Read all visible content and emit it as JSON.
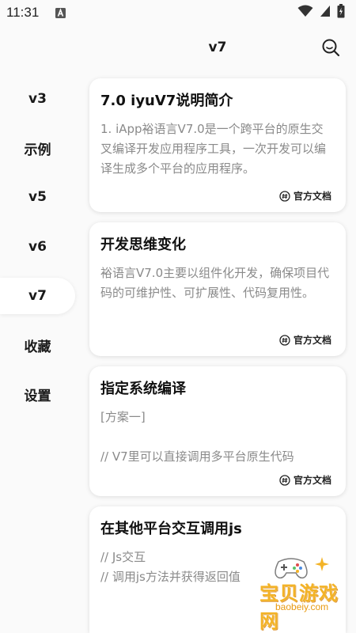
{
  "status_bar": {
    "time": "11:31"
  },
  "app_bar": {
    "title": "v7"
  },
  "sidebar": {
    "items": [
      {
        "label": "v3",
        "active": false
      },
      {
        "label": "示例",
        "active": false
      },
      {
        "label": "v5",
        "active": false
      },
      {
        "label": "v6",
        "active": false
      },
      {
        "label": "v7",
        "active": true
      },
      {
        "label": "收藏",
        "active": false
      },
      {
        "label": "设置",
        "active": false
      }
    ]
  },
  "cards": [
    {
      "title": "7.0 iyuV7说明简介",
      "body": "1. iApp裕语言V7.0是一个跨平台的原生交叉编译开发应用程序工具，一次开发可以编译生成多个平台的应用程序。",
      "footer": "官方文档"
    },
    {
      "title": "开发思维变化",
      "body": "裕语言V7.0主要以组件化开发，确保项目代码的可维护性、可扩展性、代码复用性。",
      "footer": "官方文档"
    },
    {
      "title": "指定系统编译",
      "body": "[方案一]\n\n// V7里可以直接调用多平台原生代码",
      "footer": "官方文档"
    },
    {
      "title": "在其他平台交互调用js",
      "body": "// Js交互\n// 调用js方法并获得返回值",
      "footer": ""
    }
  ],
  "watermark": {
    "title": "宝贝游戏网",
    "site": "baobeiy.com"
  }
}
